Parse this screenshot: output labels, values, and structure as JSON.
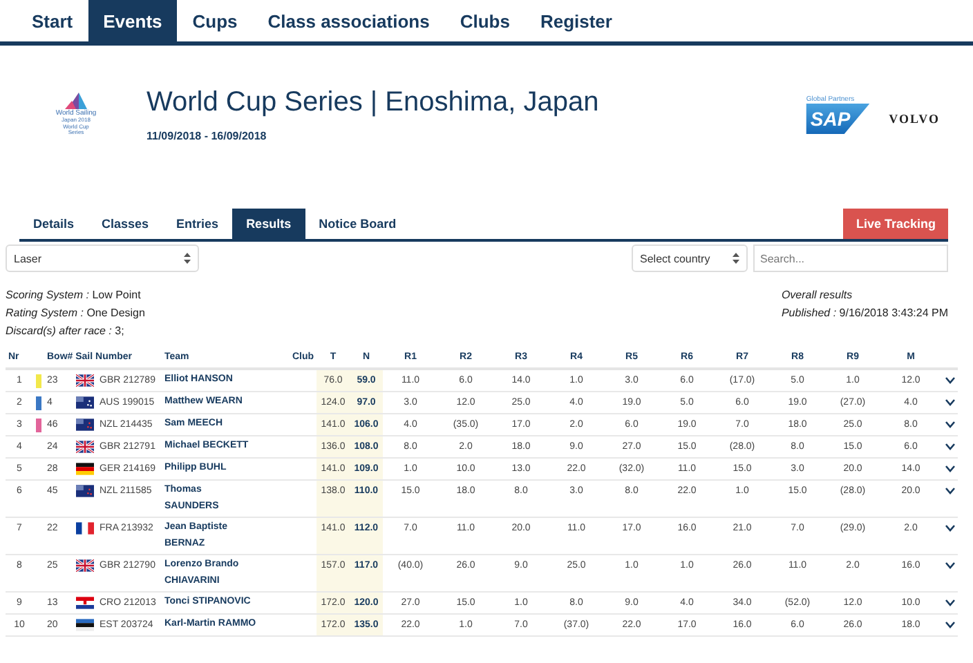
{
  "nav": [
    {
      "label": "Start",
      "selected": false
    },
    {
      "label": "Events",
      "selected": true
    },
    {
      "label": "Cups",
      "selected": false
    },
    {
      "label": "Class associations",
      "selected": false
    },
    {
      "label": "Clubs",
      "selected": false
    },
    {
      "label": "Register",
      "selected": false
    }
  ],
  "event": {
    "logo_lines": [
      "World Sailing",
      "Japan 2018",
      "World Cup",
      "Series"
    ],
    "title": "World Cup Series | Enoshima, Japan",
    "dates": "11/09/2018 - 16/09/2018",
    "partners_label": "Global Partners",
    "sponsors": [
      "SAP",
      "VOLVO"
    ]
  },
  "tabs": [
    {
      "label": "Details",
      "selected": false
    },
    {
      "label": "Classes",
      "selected": false
    },
    {
      "label": "Entries",
      "selected": false
    },
    {
      "label": "Results",
      "selected": true
    },
    {
      "label": "Notice Board",
      "selected": false
    }
  ],
  "live_button": "Live Tracking",
  "class_select": "Laser",
  "country_select": "Select country",
  "search": {
    "placeholder": "Search..."
  },
  "info_left": [
    {
      "key": "Scoring System :",
      "value": " Low Point"
    },
    {
      "key": "Rating System :",
      "value": " One Design"
    },
    {
      "key": "Discard(s) after race :",
      "value": " 3;"
    }
  ],
  "info_right": [
    {
      "key": "Overall results"
    },
    {
      "key": "Published :",
      "value": " 9/16/2018 3:43:24 PM"
    }
  ],
  "columns": [
    "Nr",
    "Bow#",
    "Sail Number",
    "Team",
    "Club",
    "T",
    "N",
    "R1",
    "R2",
    "R3",
    "R4",
    "R5",
    "R6",
    "R7",
    "R8",
    "R9",
    "M"
  ],
  "rows": [
    {
      "nr": "1",
      "color": "#f2e84b",
      "bow": "23",
      "kind": "gbr",
      "sail": "GBR 212789",
      "team": "Elliot HANSON",
      "t": "76.0",
      "n": "59.0",
      "races": [
        "11.0",
        "6.0",
        "14.0",
        "1.0",
        "3.0",
        "6.0",
        "(17.0)",
        "5.0",
        "1.0"
      ],
      "m": "12.0"
    },
    {
      "nr": "2",
      "color": "#3b78c4",
      "bow": "4",
      "kind": "aus",
      "sail": "AUS 199015",
      "team": "Matthew WEARN",
      "t": "124.0",
      "n": "97.0",
      "races": [
        "3.0",
        "12.0",
        "25.0",
        "4.0",
        "19.0",
        "5.0",
        "6.0",
        "19.0",
        "(27.0)"
      ],
      "m": "4.0"
    },
    {
      "nr": "3",
      "color": "#e2649a",
      "bow": "46",
      "kind": "nzl",
      "sail": "NZL 214435",
      "team": "Sam MEECH",
      "t": "141.0",
      "n": "106.0",
      "races": [
        "4.0",
        "(35.0)",
        "17.0",
        "2.0",
        "6.0",
        "19.0",
        "7.0",
        "18.0",
        "25.0"
      ],
      "m": "8.0"
    },
    {
      "nr": "4",
      "bow": "24",
      "kind": "gbr",
      "sail": "GBR 212791",
      "team": "Michael BECKETT",
      "t": "136.0",
      "n": "108.0",
      "races": [
        "8.0",
        "2.0",
        "18.0",
        "9.0",
        "27.0",
        "15.0",
        "(28.0)",
        "8.0",
        "15.0"
      ],
      "m": "6.0"
    },
    {
      "nr": "5",
      "bow": "28",
      "kind": "ger",
      "sail": "GER 214169",
      "team": "Philipp BUHL",
      "t": "141.0",
      "n": "109.0",
      "races": [
        "1.0",
        "10.0",
        "13.0",
        "22.0",
        "(32.0)",
        "11.0",
        "15.0",
        "3.0",
        "20.0"
      ],
      "m": "14.0"
    },
    {
      "nr": "6",
      "bow": "45",
      "kind": "nzl",
      "sail": "NZL 211585",
      "team": "Thomas SAUNDERS",
      "t": "138.0",
      "n": "110.0",
      "races": [
        "15.0",
        "18.0",
        "8.0",
        "3.0",
        "8.0",
        "22.0",
        "1.0",
        "15.0",
        "(28.0)"
      ],
      "m": "20.0"
    },
    {
      "nr": "7",
      "bow": "22",
      "kind": "fra",
      "sail": "FRA 213932",
      "team": "Jean Baptiste BERNAZ",
      "t": "141.0",
      "n": "112.0",
      "races": [
        "7.0",
        "11.0",
        "20.0",
        "11.0",
        "17.0",
        "16.0",
        "21.0",
        "7.0",
        "(29.0)"
      ],
      "m": "2.0"
    },
    {
      "nr": "8",
      "bow": "25",
      "kind": "gbr",
      "sail": "GBR 212790",
      "team": "Lorenzo Brando CHIAVARINI",
      "t": "157.0",
      "n": "117.0",
      "races": [
        "(40.0)",
        "26.0",
        "9.0",
        "25.0",
        "1.0",
        "1.0",
        "26.0",
        "11.0",
        "2.0"
      ],
      "m": "16.0"
    },
    {
      "nr": "9",
      "bow": "13",
      "kind": "cro",
      "sail": "CRO 212013",
      "team": "Tonci STIPANOVIC",
      "t": "172.0",
      "n": "120.0",
      "races": [
        "27.0",
        "15.0",
        "1.0",
        "8.0",
        "9.0",
        "4.0",
        "34.0",
        "(52.0)",
        "12.0"
      ],
      "m": "10.0"
    },
    {
      "nr": "10",
      "bow": "20",
      "kind": "est",
      "sail": "EST 203724",
      "team": "Karl-Martin RAMMO",
      "t": "172.0",
      "n": "135.0",
      "races": [
        "22.0",
        "1.0",
        "7.0",
        "(37.0)",
        "22.0",
        "17.0",
        "16.0",
        "6.0",
        "26.0"
      ],
      "m": "18.0"
    }
  ]
}
